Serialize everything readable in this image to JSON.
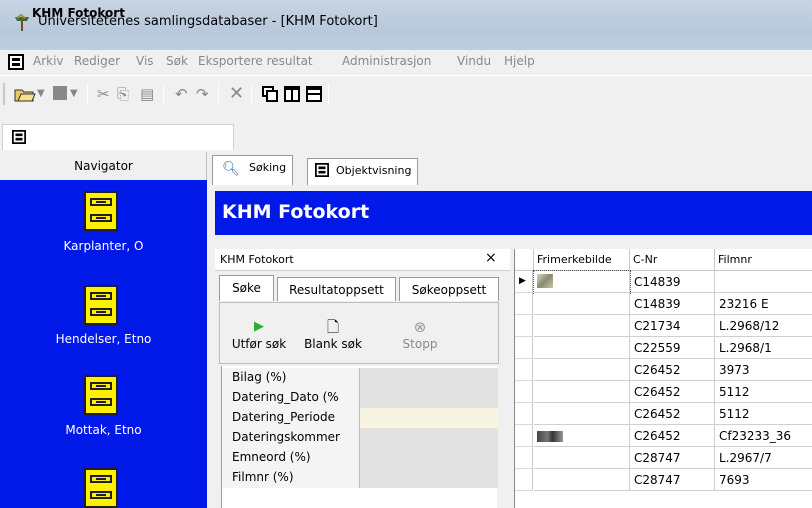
{
  "window": {
    "title": "Universitetenes samlingsdatabaser - [KHM Fotokort]"
  },
  "menu": [
    "Arkiv",
    "Rediger",
    "Vis",
    "Søk",
    "Eksportere resultat",
    "Administrasjon",
    "Vindu",
    "Hjelp"
  ],
  "toolbar": {
    "icons": [
      "open-icon",
      "dropdown-icon",
      "stop-icon",
      "cut-icon",
      "copy-icon",
      "paste-icon",
      "undo-icon",
      "redo-icon",
      "delete-icon",
      "cascade-icon",
      "tile-vertical-icon",
      "tile-horizontal-icon"
    ]
  },
  "document_tab": {
    "label": "KHM Fotokort"
  },
  "navigator": {
    "title": "Navigator",
    "items": [
      {
        "label": "Karplanter, O"
      },
      {
        "label": "Hendelser, Etno"
      },
      {
        "label": "Mottak, Etno"
      },
      {
        "label": ""
      }
    ]
  },
  "tabs": [
    {
      "label": "Søking",
      "active": true
    },
    {
      "label": "Objektvisning",
      "active": false
    }
  ],
  "header": {
    "title": "KHM Fotokort"
  },
  "search_panel": {
    "title": "KHM Fotokort",
    "close": "×",
    "tabs": [
      {
        "label": "Søke",
        "active": true
      },
      {
        "label": "Resultatoppsett",
        "active": false
      },
      {
        "label": "Søkeoppsett",
        "active": false
      }
    ],
    "buttons": [
      {
        "label": "Utfør søk",
        "icon": "run-icon",
        "enabled": true
      },
      {
        "label": "Blank søk",
        "icon": "blank-icon",
        "enabled": true
      },
      {
        "label": "Stopp",
        "icon": "stop-icon",
        "enabled": false
      }
    ],
    "fields": [
      {
        "label": "Bilag (%)",
        "value": ""
      },
      {
        "label": "Datering_Dato (%",
        "value": ""
      },
      {
        "label": "Datering_Periode",
        "value": ""
      },
      {
        "label": "Dateringskommer",
        "value": ""
      },
      {
        "label": "Emneord (%)",
        "value": ""
      },
      {
        "label": "Filmnr (%)",
        "value": ""
      }
    ]
  },
  "results": {
    "columns": [
      "Frimerkebilde",
      "C-Nr",
      "Filmnr"
    ],
    "rows": [
      {
        "thumb": "a",
        "cnr": "C14839",
        "filmnr": ""
      },
      {
        "thumb": "",
        "cnr": "C14839",
        "filmnr": "23216 E"
      },
      {
        "thumb": "",
        "cnr": "C21734",
        "filmnr": "L.2968/12"
      },
      {
        "thumb": "",
        "cnr": "C22559",
        "filmnr": "L.2968/1"
      },
      {
        "thumb": "",
        "cnr": "C26452",
        "filmnr": "3973"
      },
      {
        "thumb": "",
        "cnr": "C26452",
        "filmnr": "5112"
      },
      {
        "thumb": "",
        "cnr": "C26452",
        "filmnr": "5112"
      },
      {
        "thumb": "b",
        "cnr": "C26452",
        "filmnr": "Cf23233_36"
      },
      {
        "thumb": "",
        "cnr": "C28747",
        "filmnr": "L.2967/7"
      },
      {
        "thumb": "",
        "cnr": "C28747",
        "filmnr": "7693"
      }
    ]
  },
  "colors": {
    "navigator_bg": "#0018e8",
    "header_bg": "#0018e8",
    "cabinet": "#ffef00"
  }
}
